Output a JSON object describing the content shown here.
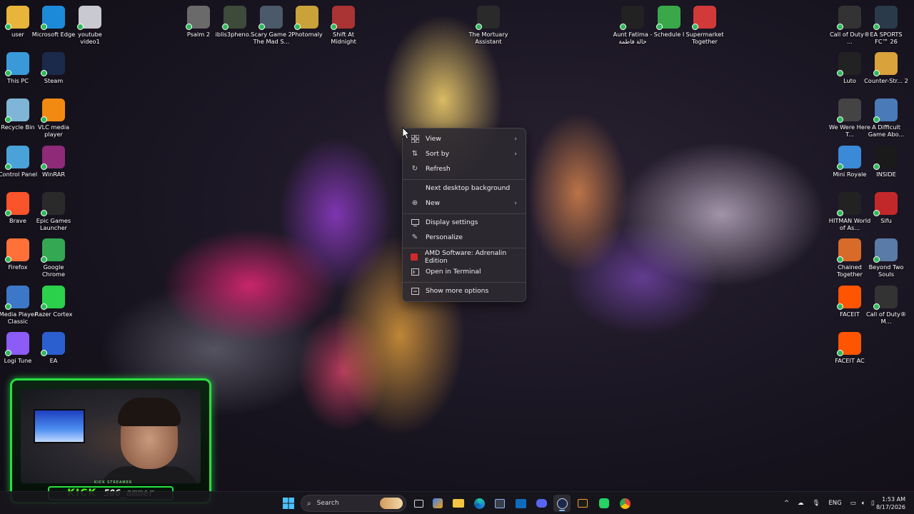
{
  "desktop_icons": [
    {
      "id": "user",
      "label": "user",
      "icon": "folder-icon",
      "color": "#e8b53a"
    },
    {
      "id": "edge",
      "label": "Microsoft Edge",
      "icon": "edge-icon",
      "color": "#1c8ad8"
    },
    {
      "id": "youtube-video1",
      "label": "youtube video1",
      "icon": "video-file-icon",
      "color": "#c9c9d1"
    },
    {
      "id": "this-pc",
      "label": "This PC",
      "icon": "monitor-icon",
      "color": "#3a9ad9"
    },
    {
      "id": "steam",
      "label": "Steam",
      "icon": "steam-icon",
      "color": "#1b2a4a"
    },
    {
      "id": "recycle-bin",
      "label": "Recycle Bin",
      "icon": "recycle-bin-icon",
      "color": "#7fb6d8"
    },
    {
      "id": "vlc",
      "label": "VLC media player",
      "icon": "vlc-cone-icon",
      "color": "#f28a12"
    },
    {
      "id": "control-panel",
      "label": "Control Panel",
      "icon": "control-panel-icon",
      "color": "#4aa3d8"
    },
    {
      "id": "winrar",
      "label": "WinRAR",
      "icon": "winrar-icon",
      "color": "#8e2a78"
    },
    {
      "id": "brave",
      "label": "Brave",
      "icon": "brave-lion-icon",
      "color": "#fb542b"
    },
    {
      "id": "epic-launcher",
      "label": "Epic Games Launcher",
      "icon": "epic-games-icon",
      "color": "#2a2a2a"
    },
    {
      "id": "firefox",
      "label": "Firefox",
      "icon": "firefox-icon",
      "color": "#ff7139"
    },
    {
      "id": "chrome",
      "label": "Google Chrome",
      "icon": "chrome-icon",
      "color": "#34a853"
    },
    {
      "id": "mpc",
      "label": "Media Player Classic",
      "icon": "media-player-classic-icon",
      "color": "#3d78c8"
    },
    {
      "id": "razer-cortex",
      "label": "Razer Cortex",
      "icon": "razer-cortex-icon",
      "color": "#2bd14a"
    },
    {
      "id": "logi-tune",
      "label": "Logi Tune",
      "icon": "logi-tune-icon",
      "color": "#8b5cf6"
    },
    {
      "id": "ea",
      "label": "EA",
      "icon": "ea-icon",
      "color": "#2b5fd0"
    },
    {
      "id": "psalm2",
      "label": "Psalm 2",
      "icon": "skull-game-icon",
      "color": "#6a6a6a"
    },
    {
      "id": "iblis",
      "label": "iblis3pheno...",
      "icon": "iblis-game-icon",
      "color": "#3e4a3a"
    },
    {
      "id": "scary-game",
      "label": "Scary Game 2 The Mad S...",
      "icon": "scary-game-icon",
      "color": "#4a5a6a"
    },
    {
      "id": "photomaly",
      "label": "Photomaly",
      "icon": "photomaly-icon",
      "color": "#c9a23a"
    },
    {
      "id": "shift-midnight",
      "label": "Shift At Midnight",
      "icon": "shift-at-midnight-icon",
      "color": "#a33"
    },
    {
      "id": "mortuary",
      "label": "The Mortuary Assistant",
      "icon": "mortuary-assistant-icon",
      "color": "#2a2a2a"
    },
    {
      "id": "aunt-fatima",
      "label": "Aunt Fatima - خالة فاطمة",
      "icon": "aunt-fatima-icon",
      "color": "#222"
    },
    {
      "id": "schedule1",
      "label": "Schedule I",
      "icon": "schedule-one-icon",
      "color": "#3aa84a"
    },
    {
      "id": "supermarket",
      "label": "Supermarket Together",
      "icon": "supermarket-together-icon",
      "color": "#d23a3a"
    },
    {
      "id": "cod-mw",
      "label": "Call of Duty® ...",
      "icon": "call-of-duty-icon",
      "color": "#333"
    },
    {
      "id": "ea-fc",
      "label": "EA SPORTS FC™ 26",
      "icon": "ea-fc-icon",
      "color": "#2a3a4a"
    },
    {
      "id": "luto",
      "label": "Luto",
      "icon": "epic-games-icon",
      "color": "#222"
    },
    {
      "id": "counter-strike",
      "label": "Counter-Str... 2",
      "icon": "counter-strike-icon",
      "color": "#d9a23a"
    },
    {
      "id": "we-were-here",
      "label": "We Were Here T...",
      "icon": "walkie-talkie-icon",
      "color": "#444"
    },
    {
      "id": "difficult-game",
      "label": "A Difficult Game Abo...",
      "icon": "difficult-game-icon",
      "color": "#4a7ab8"
    },
    {
      "id": "mini-royale",
      "label": "Mini Royale",
      "icon": "mini-royale-icon",
      "color": "#3a8ad8"
    },
    {
      "id": "inside",
      "label": "INSIDE",
      "icon": "inside-icon",
      "color": "#1a1a1a"
    },
    {
      "id": "hitman",
      "label": "HITMAN World of As...",
      "icon": "hitman-icon",
      "color": "#222"
    },
    {
      "id": "sifu",
      "label": "Sifu",
      "icon": "sifu-icon",
      "color": "#c2282a"
    },
    {
      "id": "chained",
      "label": "Chained Together",
      "icon": "chained-together-icon",
      "color": "#d86a2a"
    },
    {
      "id": "beyond",
      "label": "Beyond Two Souls",
      "icon": "beyond-two-souls-icon",
      "color": "#5a7aa8"
    },
    {
      "id": "faceit",
      "label": "FACEIT",
      "icon": "faceit-icon",
      "color": "#ff5500"
    },
    {
      "id": "cod-mw2",
      "label": "Call of Duty® M...",
      "icon": "call-of-duty-icon",
      "color": "#333"
    },
    {
      "id": "faceit-ac",
      "label": "FACEIT AC",
      "icon": "faceit-ac-icon",
      "color": "#ff5500"
    }
  ],
  "context_menu": {
    "items": [
      {
        "label": "View",
        "icon": "grid-icon",
        "submenu": true
      },
      {
        "label": "Sort by",
        "icon": "sort-icon",
        "submenu": true
      },
      {
        "label": "Refresh",
        "icon": "refresh-icon",
        "submenu": false
      },
      {
        "label": "Next desktop background",
        "icon": "",
        "submenu": false
      },
      {
        "label": "New",
        "icon": "plus-circle-icon",
        "submenu": true
      },
      {
        "label": "Display settings",
        "icon": "display-icon",
        "submenu": false
      },
      {
        "label": "Personalize",
        "icon": "pen-icon",
        "submenu": false
      },
      {
        "label": "AMD Software: Adrenalin Edition",
        "icon": "amd-icon",
        "submenu": false
      },
      {
        "label": "Open in Terminal",
        "icon": "terminal-icon",
        "submenu": false
      },
      {
        "label": "Show more options",
        "icon": "more-options-icon",
        "submenu": false
      }
    ]
  },
  "webcam": {
    "platform": "KICK",
    "username": "506_ammer",
    "tagline": "KICK STREAMER",
    "accent": "#27e040"
  },
  "taskbar": {
    "search_placeholder": "Search",
    "apps": [
      "start-icon",
      "search-icon",
      "task-view-icon",
      "widgets-icon",
      "file-explorer-icon",
      "edge-icon",
      "store-icon",
      "outlook-icon",
      "discord-icon",
      "steam-icon",
      "terminal-icon",
      "whatsapp-icon",
      "chrome-icon"
    ],
    "tray": {
      "language": "ENG",
      "time": "1:53 AM",
      "date": "8/17/2026"
    }
  },
  "colors": {
    "menu_bg": "#2c2930",
    "taskbar_bg": "#18161c",
    "kick_green": "#53fc18"
  }
}
